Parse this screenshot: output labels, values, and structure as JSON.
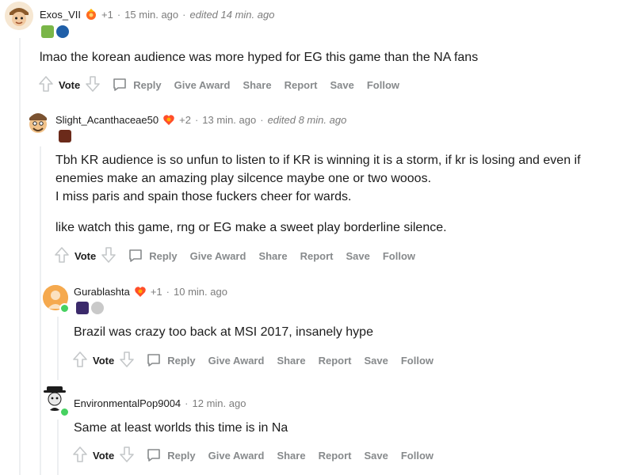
{
  "colors": {
    "accent_gray": "#878a8c",
    "online": "#46d160",
    "thread_line": "#edeff1",
    "text": "#1c1c1c"
  },
  "comments": [
    {
      "username": "Exos_VII",
      "score_delta": "+1",
      "time": "15 min. ago",
      "edited": "edited 14 min. ago",
      "body": [
        "lmao the korean audience was more hyped for EG this game than the NA fans"
      ],
      "actions": {
        "vote": "Vote",
        "reply": "Reply",
        "give_award": "Give Award",
        "share": "Share",
        "report": "Report",
        "save": "Save",
        "follow": "Follow"
      }
    },
    {
      "username": "Slight_Acanthaceae50",
      "score_delta": "+2",
      "time": "13 min. ago",
      "edited": "edited 8 min. ago",
      "body": [
        "Tbh KR audience is so unfun to listen to if KR is winning it is a storm, if kr is losing and even if enemies make an amazing play silcence maybe one or two wooos.",
        "I miss paris and spain those fuckers cheer for wards.",
        "like watch this game, rng or EG make a sweet play borderline silence."
      ],
      "actions": {
        "vote": "Vote",
        "reply": "Reply",
        "give_award": "Give Award",
        "share": "Share",
        "report": "Report",
        "save": "Save",
        "follow": "Follow"
      }
    },
    {
      "username": "Gurablashta",
      "score_delta": "+1",
      "time": "10 min. ago",
      "body": [
        "Brazil was crazy too back at MSI 2017, insanely hype"
      ],
      "actions": {
        "vote": "Vote",
        "reply": "Reply",
        "give_award": "Give Award",
        "share": "Share",
        "report": "Report",
        "save": "Save",
        "follow": "Follow"
      }
    },
    {
      "username": "EnvironmentalPop9004",
      "time": "12 min. ago",
      "body": [
        "Same at least worlds this time is in Na"
      ],
      "actions": {
        "vote": "Vote",
        "reply": "Reply",
        "give_award": "Give Award",
        "share": "Share",
        "report": "Report",
        "save": "Save",
        "follow": "Follow"
      }
    }
  ]
}
